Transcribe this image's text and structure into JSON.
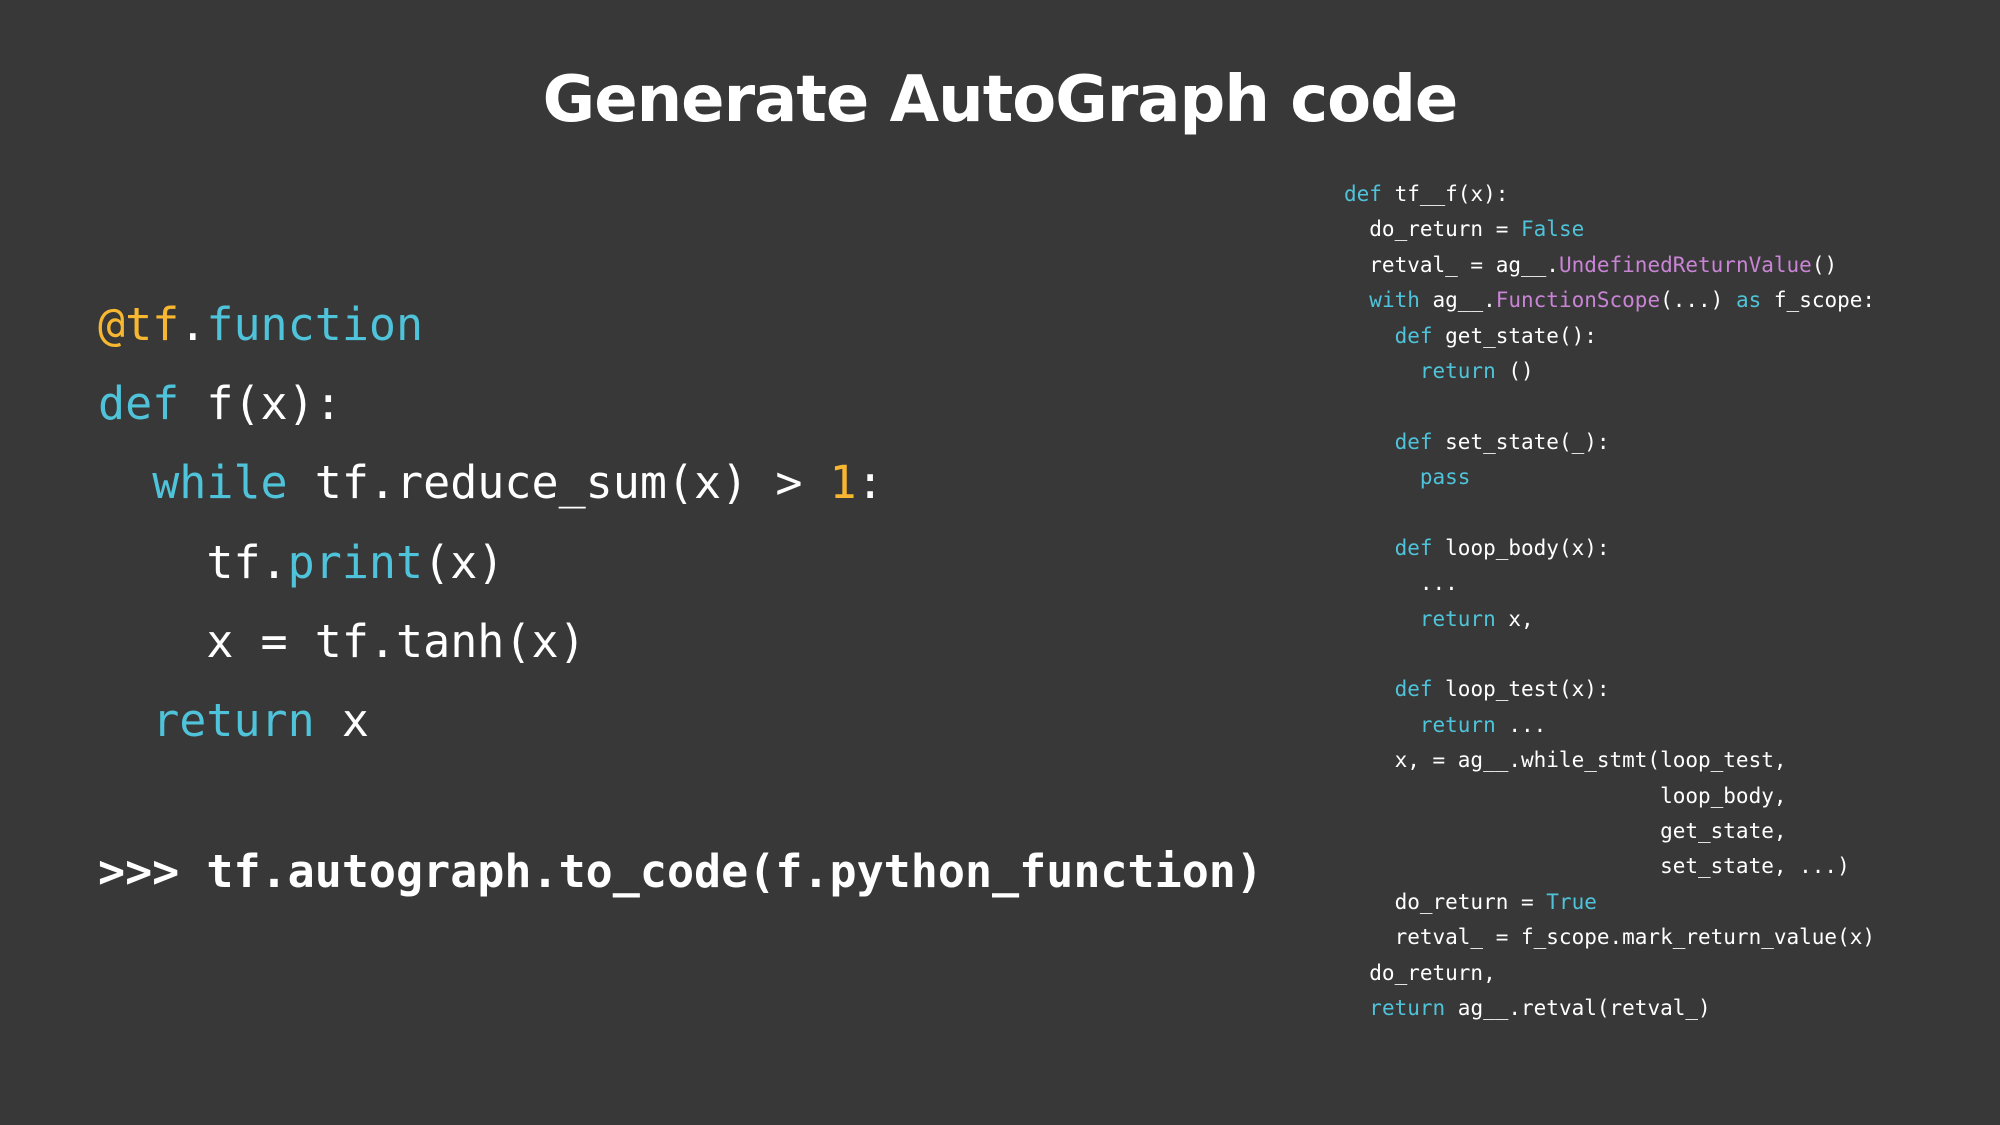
{
  "title": "Generate AutoGraph code",
  "colors": {
    "background": "#383838",
    "text": "#ffffff",
    "keyword": "#4fc3d9",
    "number_and_decorator": "#f7b731",
    "call": "#c984d6"
  },
  "left_code": {
    "line1": {
      "decorator": "@tf",
      "dot": ".",
      "name": "function"
    },
    "line2": {
      "kw": "def",
      "rest": " f(x):"
    },
    "line3": {
      "indent": "  ",
      "kw": "while",
      "mid": " tf.reduce_sum(x) > ",
      "num": "1",
      "end": ":"
    },
    "line4": {
      "indent": "    ",
      "pre": "tf.",
      "fn": "print",
      "post": "(x)"
    },
    "line5": {
      "indent": "    ",
      "text": "x = tf.tanh(x)"
    },
    "line6": {
      "indent": "  ",
      "kw": "return",
      "rest": " x"
    }
  },
  "repl": {
    "prompt": ">>> ",
    "command": "tf.autograph.to_code(f.python_function)"
  },
  "right_code": {
    "l1": {
      "kw": "def",
      "rest": " tf__f(x):"
    },
    "l2": {
      "pre": "  do_return = ",
      "kw": "False"
    },
    "l3": {
      "pre": "  retval_ = ag__.",
      "fn": "UndefinedReturnValue",
      "post": "()"
    },
    "l4": {
      "indent": "  ",
      "kw": "with",
      "mid": " ag__.",
      "fn": "FunctionScope",
      "mid2": "(...) ",
      "kw2": "as",
      "post": " f_scope:"
    },
    "l5": {
      "indent": "    ",
      "kw": "def",
      "rest": " get_state():"
    },
    "l6": {
      "indent": "      ",
      "kw": "return",
      "rest": " ()"
    },
    "l8": {
      "indent": "    ",
      "kw": "def",
      "rest": " set_state(_):"
    },
    "l9": {
      "indent": "      ",
      "kw": "pass"
    },
    "l11": {
      "indent": "    ",
      "kw": "def",
      "rest": " loop_body(x):"
    },
    "l12": {
      "text": "      ..."
    },
    "l13": {
      "indent": "      ",
      "kw": "return",
      "rest": " x,"
    },
    "l15": {
      "indent": "    ",
      "kw": "def",
      "rest": " loop_test(x):"
    },
    "l16": {
      "indent": "      ",
      "kw": "return",
      "rest": " ..."
    },
    "l17": {
      "text": "    x, = ag__.while_stmt(loop_test,"
    },
    "l18": {
      "text": "                         loop_body,"
    },
    "l19": {
      "text": "                         get_state,"
    },
    "l20": {
      "text": "                         set_state, ...)"
    },
    "l21": {
      "pre": "    do_return = ",
      "kw": "True"
    },
    "l22": {
      "text": "    retval_ = f_scope.mark_return_value(x)"
    },
    "l23": {
      "text": "  do_return,"
    },
    "l24": {
      "indent": "  ",
      "kw": "return",
      "rest": " ag__.retval(retval_)"
    }
  }
}
